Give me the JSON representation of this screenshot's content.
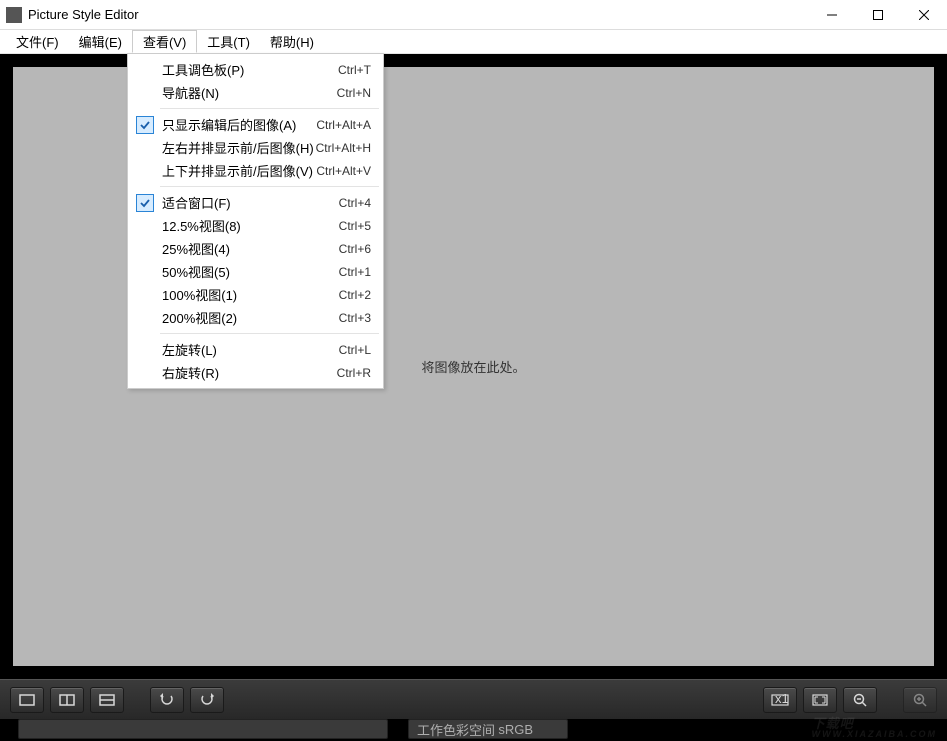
{
  "window": {
    "title": "Picture Style Editor"
  },
  "menubar": {
    "file": "文件(F)",
    "edit": "编辑(E)",
    "view": "查看(V)",
    "tools": "工具(T)",
    "help": "帮助(H)"
  },
  "view_menu": {
    "groups": [
      [
        {
          "label": "工具调色板(P)",
          "accel": "Ctrl+T",
          "checked": false
        },
        {
          "label": "导航器(N)",
          "accel": "Ctrl+N",
          "checked": false
        }
      ],
      [
        {
          "label": "只显示编辑后的图像(A)",
          "accel": "Ctrl+Alt+A",
          "checked": true
        },
        {
          "label": "左右并排显示前/后图像(H)",
          "accel": "Ctrl+Alt+H",
          "checked": false
        },
        {
          "label": "上下并排显示前/后图像(V)",
          "accel": "Ctrl+Alt+V",
          "checked": false
        }
      ],
      [
        {
          "label": "适合窗口(F)",
          "accel": "Ctrl+4",
          "checked": true
        },
        {
          "label": "12.5%视图(8)",
          "accel": "Ctrl+5",
          "checked": false
        },
        {
          "label": "25%视图(4)",
          "accel": "Ctrl+6",
          "checked": false
        },
        {
          "label": "50%视图(5)",
          "accel": "Ctrl+1",
          "checked": false
        },
        {
          "label": "100%视图(1)",
          "accel": "Ctrl+2",
          "checked": false
        },
        {
          "label": "200%视图(2)",
          "accel": "Ctrl+3",
          "checked": false
        }
      ],
      [
        {
          "label": "左旋转(L)",
          "accel": "Ctrl+L",
          "checked": false
        },
        {
          "label": "右旋转(R)",
          "accel": "Ctrl+R",
          "checked": false
        }
      ]
    ]
  },
  "canvas": {
    "placeholder": "将图像放在此处。"
  },
  "statusbar": {
    "colorspace_label": "工作色彩空间",
    "colorspace_value": "sRGB"
  },
  "watermark": {
    "text": "下载吧",
    "sub": "WWW.XIAZAIBA.COM"
  }
}
